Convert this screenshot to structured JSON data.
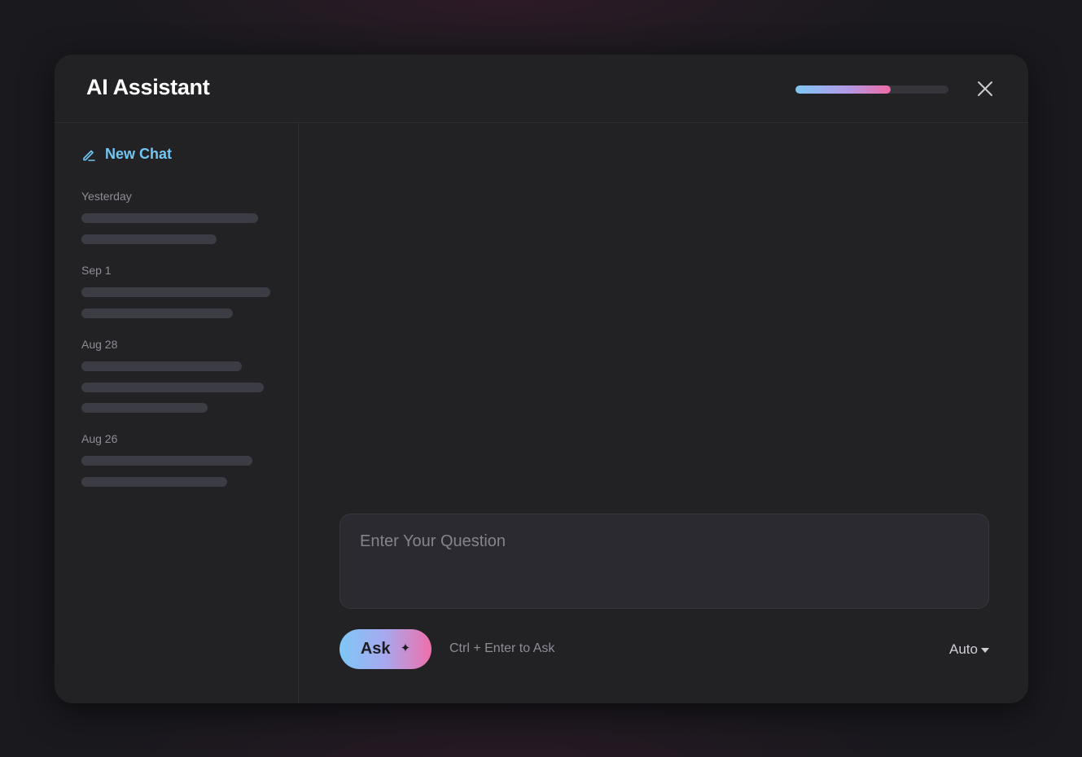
{
  "app": {
    "title": "AI Assistant",
    "progress_fraction": 0.62,
    "accent_color": "#72c6f2",
    "gradient_colors": [
      "#7fc8f3",
      "#b49ae6",
      "#ee6aa6"
    ]
  },
  "header": {
    "close_icon": "close-icon"
  },
  "sidebar": {
    "new_chat_label": "New Chat",
    "new_chat_icon": "pencil-icon",
    "groups": [
      {
        "label": "Yesterday"
      },
      {
        "label": "Sep 1"
      },
      {
        "label": "Aug 28"
      },
      {
        "label": "Aug 26"
      }
    ]
  },
  "composer": {
    "placeholder": "Enter Your Question",
    "value": "",
    "ask_label": "Ask",
    "ask_icon": "sparkle-icon",
    "hint": "Ctrl + Enter to Ask",
    "mode": "Auto",
    "mode_icon": "chevron-down-icon"
  }
}
